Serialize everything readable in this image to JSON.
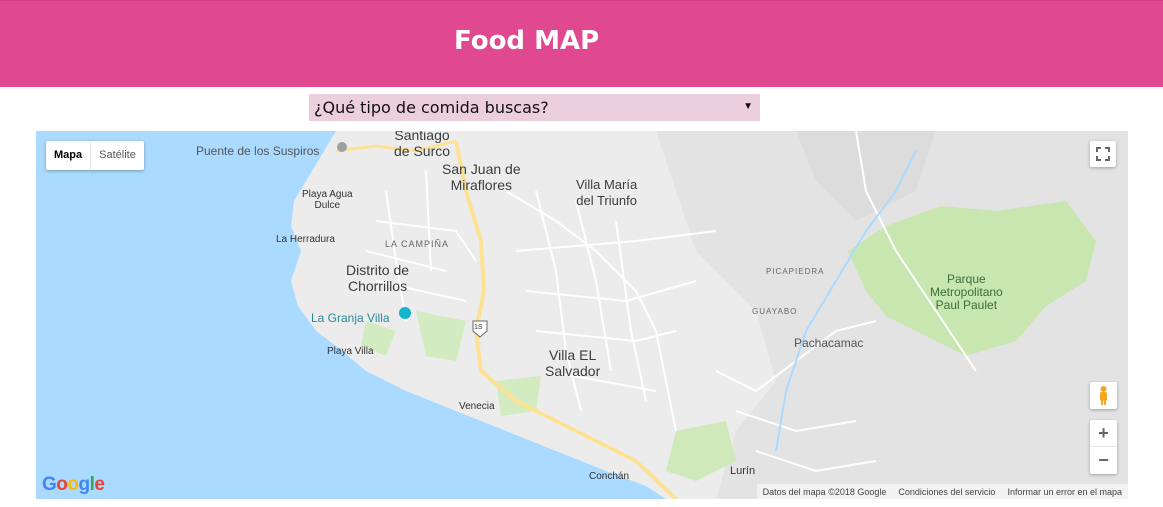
{
  "header": {
    "title": "Food MAP",
    "bg_color": "#e04890"
  },
  "search": {
    "select_value": "¿Qué tipo de comida buscas?",
    "arrow": "▼",
    "bg_color": "#eccfdc"
  },
  "map": {
    "map_type": {
      "map_label": "Mapa",
      "satellite_label": "Satélite",
      "active": "Mapa"
    },
    "places": {
      "santiago_surco": "Santiago de Surco",
      "santiago_line1": "Santiago",
      "santiago_line2": "de Surco",
      "puente_suspiros": "Puente de los Suspiros",
      "playa_agua_dulce_1": "Playa Agua",
      "playa_agua_dulce_2": "Dulce",
      "la_herradura": "La Herradura",
      "la_campina": "LA CAMPIÑA",
      "chorrillos_1": "Distrito de",
      "chorrillos_2": "Chorrillos",
      "la_granja_villa": "La Granja Villa",
      "playa_villa": "Playa Villa",
      "sjm_1": "San Juan de",
      "sjm_2": "Miraflores",
      "vmt_1": "Villa María",
      "vmt_2": "del Triunfo",
      "ves_1": "Villa EL",
      "ves_2": "Salvador",
      "venecia": "Venecia",
      "conchan": "Conchán",
      "lurin": "Lurín",
      "picapiedra": "PICAPIEDRA",
      "guayabo": "GUAYABO",
      "pachacamac": "Pachacamac",
      "parque_1": "Parque",
      "parque_2": "Metropolitano",
      "parque_3": "Paul Paulet",
      "highway": "1S"
    },
    "google_logo": [
      "G",
      "o",
      "o",
      "g",
      "l",
      "e"
    ],
    "google_colors": [
      "#4285f4",
      "#ea4335",
      "#fbbc05",
      "#4285f4",
      "#34a853",
      "#ea4335"
    ],
    "footer": {
      "data": "Datos del mapa ©2018 Google",
      "terms": "Condiciones del servicio",
      "report": "Informar un error en el mapa"
    },
    "controls": {
      "zoom_in": "+",
      "zoom_out": "−"
    },
    "colors": {
      "water": "#aadaff",
      "land": "#ececec",
      "park": "#c8e6b0",
      "road_major": "#fde293",
      "road": "#ffffff"
    }
  }
}
